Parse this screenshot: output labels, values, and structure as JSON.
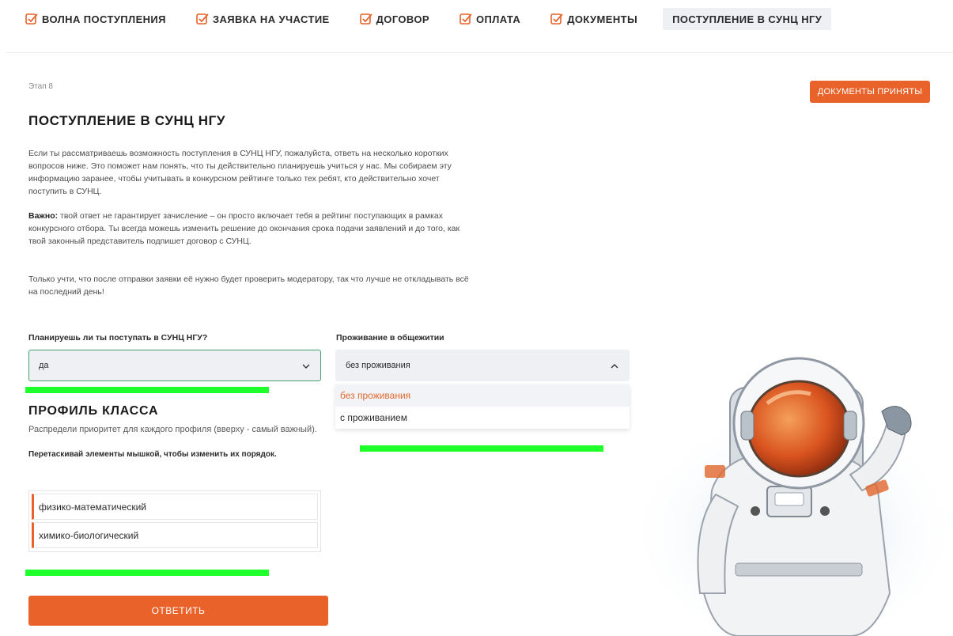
{
  "nav": {
    "items": [
      {
        "label": "ВОЛНА ПОСТУПЛЕНИЯ",
        "checked": true
      },
      {
        "label": "ЗАЯВКА НА УЧАСТИЕ",
        "checked": true
      },
      {
        "label": "ДОГОВОР",
        "checked": true
      },
      {
        "label": "ОПЛАТА",
        "checked": true
      },
      {
        "label": "ДОКУМЕНТЫ",
        "checked": true
      },
      {
        "label": "ПОСТУПЛЕНИЕ В СУНЦ НГУ",
        "checked": false,
        "active": true
      }
    ]
  },
  "stage": "Этап 8",
  "status_button": "ДОКУМЕНТЫ ПРИНЯТЫ",
  "title": "ПОСТУПЛЕНИЕ В СУНЦ НГУ",
  "paragraphs": {
    "p1": "Если ты рассматриваешь возможность поступления в СУНЦ НГУ, пожалуйста, ответь на несколько коротких вопросов ниже. Это поможет нам понять, что ты действительно планируешь учиться у нас. Мы собираем эту информацию заранее, чтобы учитывать в конкурсном рейтинге только тех ребят, кто действительно хочет поступить в СУНЦ.",
    "p2_bold": "Важно:",
    "p2": " твой ответ не гарантирует зачисление – он просто включает тебя в рейтинг поступающих в рамках конкурсного отбора. Ты всегда можешь изменить решение до окончания срока подачи заявлений и до того, как твой законный представитель подпишет договор с СУНЦ.",
    "p3": "Только учти, что после отправки заявки её нужно будет проверить модератору, так что лучше не откладывать всё на последний день!"
  },
  "plan_field": {
    "label": "Планируешь ли ты поступать в СУНЦ НГУ?",
    "value": "да"
  },
  "dorm_field": {
    "label": "Проживание в общежитии",
    "value": "без проживания",
    "options": [
      "без проживания",
      "с проживанием"
    ],
    "selected_index": 0
  },
  "profile": {
    "title": "ПРОФИЛЬ КЛАССА",
    "description": "Распредели приоритет для каждого профиля (вверху - самый важный).",
    "hint": "Перетаскивай элементы мышкой, чтобы изменить их порядок.",
    "items": [
      "физико-математический",
      "химико-биологический"
    ]
  },
  "submit_label": "ОТВЕТИТЬ",
  "colors": {
    "accent": "#e8622a",
    "highlight": "#1fff2c",
    "valid_border": "#49a36d",
    "field_bg": "#eef0f3"
  }
}
